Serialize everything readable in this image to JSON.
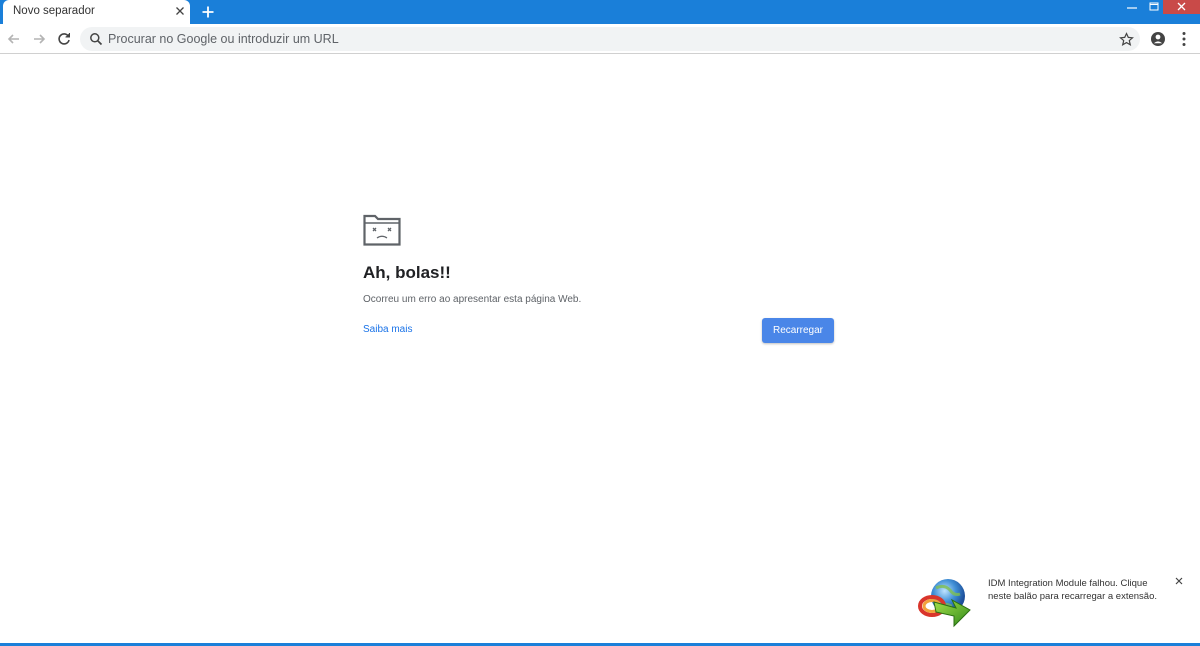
{
  "tab": {
    "title": "Novo separador"
  },
  "omnibox": {
    "placeholder": "Procurar no Google ou introduzir um URL"
  },
  "error": {
    "title": "Ah, bolas!!",
    "message": "Ocorreu um erro ao apresentar esta página Web.",
    "learn_more": "Saiba mais",
    "reload_button": "Recarregar"
  },
  "idm_balloon": {
    "line1": "IDM Integration Module falhou. Clique",
    "line2": "neste balão para recarregar a extensão."
  },
  "colors": {
    "titlebar": "#1a7fd9",
    "accent_button": "#4a86e8",
    "link": "#1a73e8",
    "close_red": "#c94a48"
  },
  "icons": [
    "close-icon",
    "plus-icon",
    "minimize-icon",
    "maximize-icon",
    "back-arrow-icon",
    "forward-arrow-icon",
    "reload-icon",
    "search-icon",
    "star-icon",
    "account-icon",
    "menu-dots-icon",
    "sad-folder-icon",
    "idm-logo-icon"
  ]
}
